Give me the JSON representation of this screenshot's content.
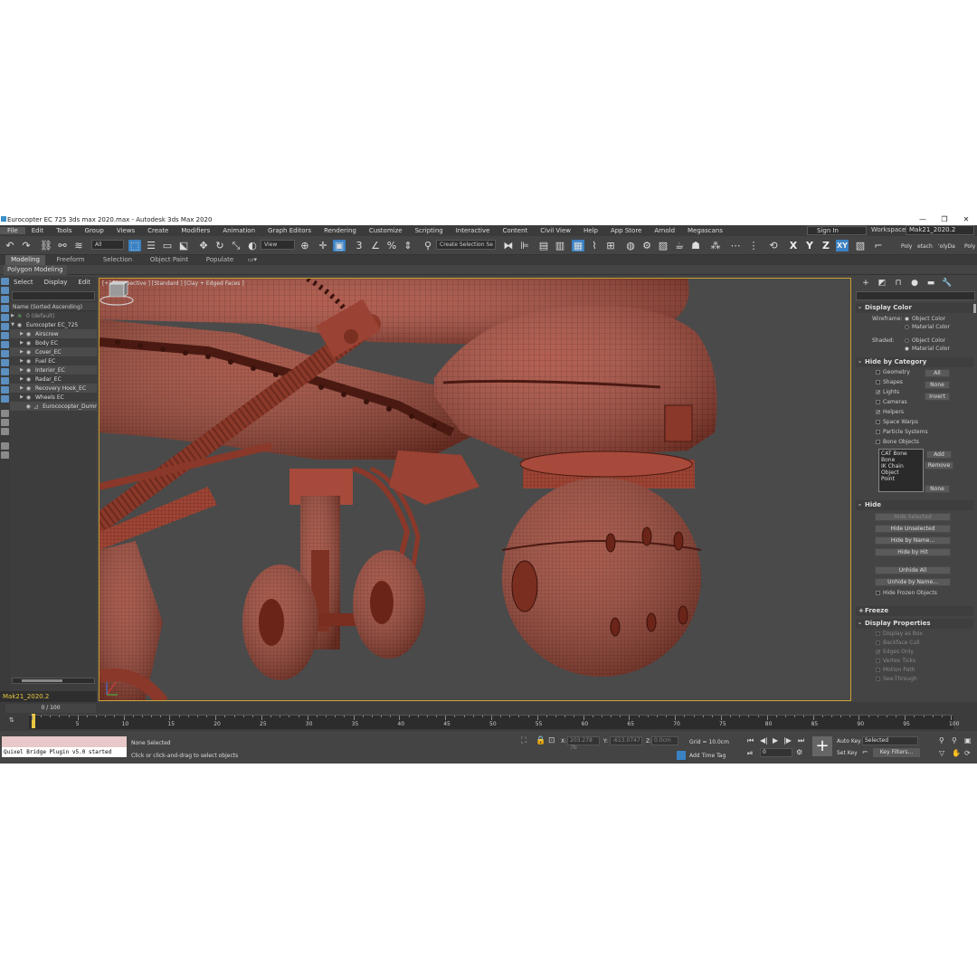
{
  "window": {
    "title": "Eurocopter EC 725 3ds max 2020.max - Autodesk 3ds Max 2020",
    "controls": [
      "—",
      "❐",
      "✕"
    ]
  },
  "menubar": [
    "File",
    "Edit",
    "Tools",
    "Group",
    "Views",
    "Create",
    "Modifiers",
    "Animation",
    "Graph Editors",
    "Rendering",
    "Customize",
    "Scripting",
    "Interactive",
    "Content",
    "Civil View",
    "Help",
    "App Store",
    "Arnold",
    "Megascans"
  ],
  "account": {
    "signin": "Sign In",
    "workspaces_label": "Workspaces:",
    "workspace": "Mak21_2020.2"
  },
  "toolbar": {
    "filter": "All",
    "coord_system": "View",
    "selection_set": "Create Selection Se",
    "axes": [
      "X",
      "Y",
      "Z",
      "XY"
    ],
    "right_labels": [
      "Poly",
      "etach",
      "'olyDa",
      "Poly"
    ]
  },
  "ribbon": {
    "tabs": [
      "Modeling",
      "Freeform",
      "Selection",
      "Object Paint",
      "Populate"
    ],
    "sub": "Polygon Modeling"
  },
  "scene_explorer": {
    "menus": [
      "Select",
      "Display",
      "Edit"
    ],
    "header": "Name (Sorted Ascending)",
    "rows": [
      {
        "label": "0 (default)",
        "indent": 0,
        "dim": true
      },
      {
        "label": "Eurocopter EC_725",
        "indent": 0
      },
      {
        "label": "Airscrew",
        "indent": 1
      },
      {
        "label": "Body EC",
        "indent": 1
      },
      {
        "label": "Cover_EC",
        "indent": 1
      },
      {
        "label": "Fuel EC",
        "indent": 1
      },
      {
        "label": "Interior_EC",
        "indent": 1
      },
      {
        "label": "Radar_EC",
        "indent": 1
      },
      {
        "label": "Recovery Hook_EC",
        "indent": 1
      },
      {
        "label": "Wheels EC",
        "indent": 1
      },
      {
        "label": "Eurococopter_Dumm",
        "indent": 1
      }
    ],
    "layer": "Mak21_2020.2"
  },
  "viewport": {
    "label": "[+] [Perspective ] [Standard ] [Clay + Edged Faces ]"
  },
  "command_panel": {
    "display_color": {
      "title": "Display Color",
      "wireframe_label": "Wireframe:",
      "shaded_label": "Shaded:",
      "object_color": "Object Color",
      "material_color": "Material Color"
    },
    "hide_by_category": {
      "title": "Hide by Category",
      "items": [
        "Geometry",
        "Shapes",
        "Lights",
        "Cameras",
        "Helpers",
        "Space Warps",
        "Particle Systems",
        "Bone Objects"
      ],
      "buttons": [
        "All",
        "None",
        "Invert"
      ],
      "list": [
        "CAT Bone",
        "Bone",
        "IK Chain Object",
        "Point"
      ],
      "list_buttons": [
        "Add",
        "Remove",
        "None"
      ]
    },
    "hide": {
      "title": "Hide",
      "buttons": [
        "Hide Selected",
        "Hide Unselected",
        "Hide by Name...",
        "Hide by Hit",
        "Unhide All",
        "Unhide by Name..."
      ],
      "frozen": "Hide Frozen Objects"
    },
    "freeze": {
      "title": "Freeze"
    },
    "display_properties": {
      "title": "Display Properties",
      "items": [
        "Display as Box",
        "Backface Cull",
        "Edges Only",
        "Vertex Ticks",
        "Motion Path",
        "See-Through"
      ]
    }
  },
  "timeline": {
    "frame": "0 / 100",
    "ticks": [
      0,
      5,
      10,
      15,
      20,
      25,
      30,
      35,
      40,
      45,
      50,
      55,
      60,
      65,
      70,
      75,
      80,
      85,
      90,
      95,
      100
    ]
  },
  "status": {
    "quixel": "Quixel Bridge Plugin v5.0 started",
    "selection": "None Selected",
    "hint": "Click or click-and-drag to select objects",
    "x_label": "X:",
    "x_value": "203.278 7b",
    "y_label": "Y:",
    "y_value": "-613.0747",
    "z_label": "Z:",
    "z_value": "0.0cm",
    "grid": "Grid = 10.0cm",
    "add_time_tag": "Add Time Tag",
    "auto_key": "Auto Key",
    "set_key": "Set Key",
    "selected": "Selected",
    "key_filters": "Key Filters...",
    "frame_field": "0"
  }
}
